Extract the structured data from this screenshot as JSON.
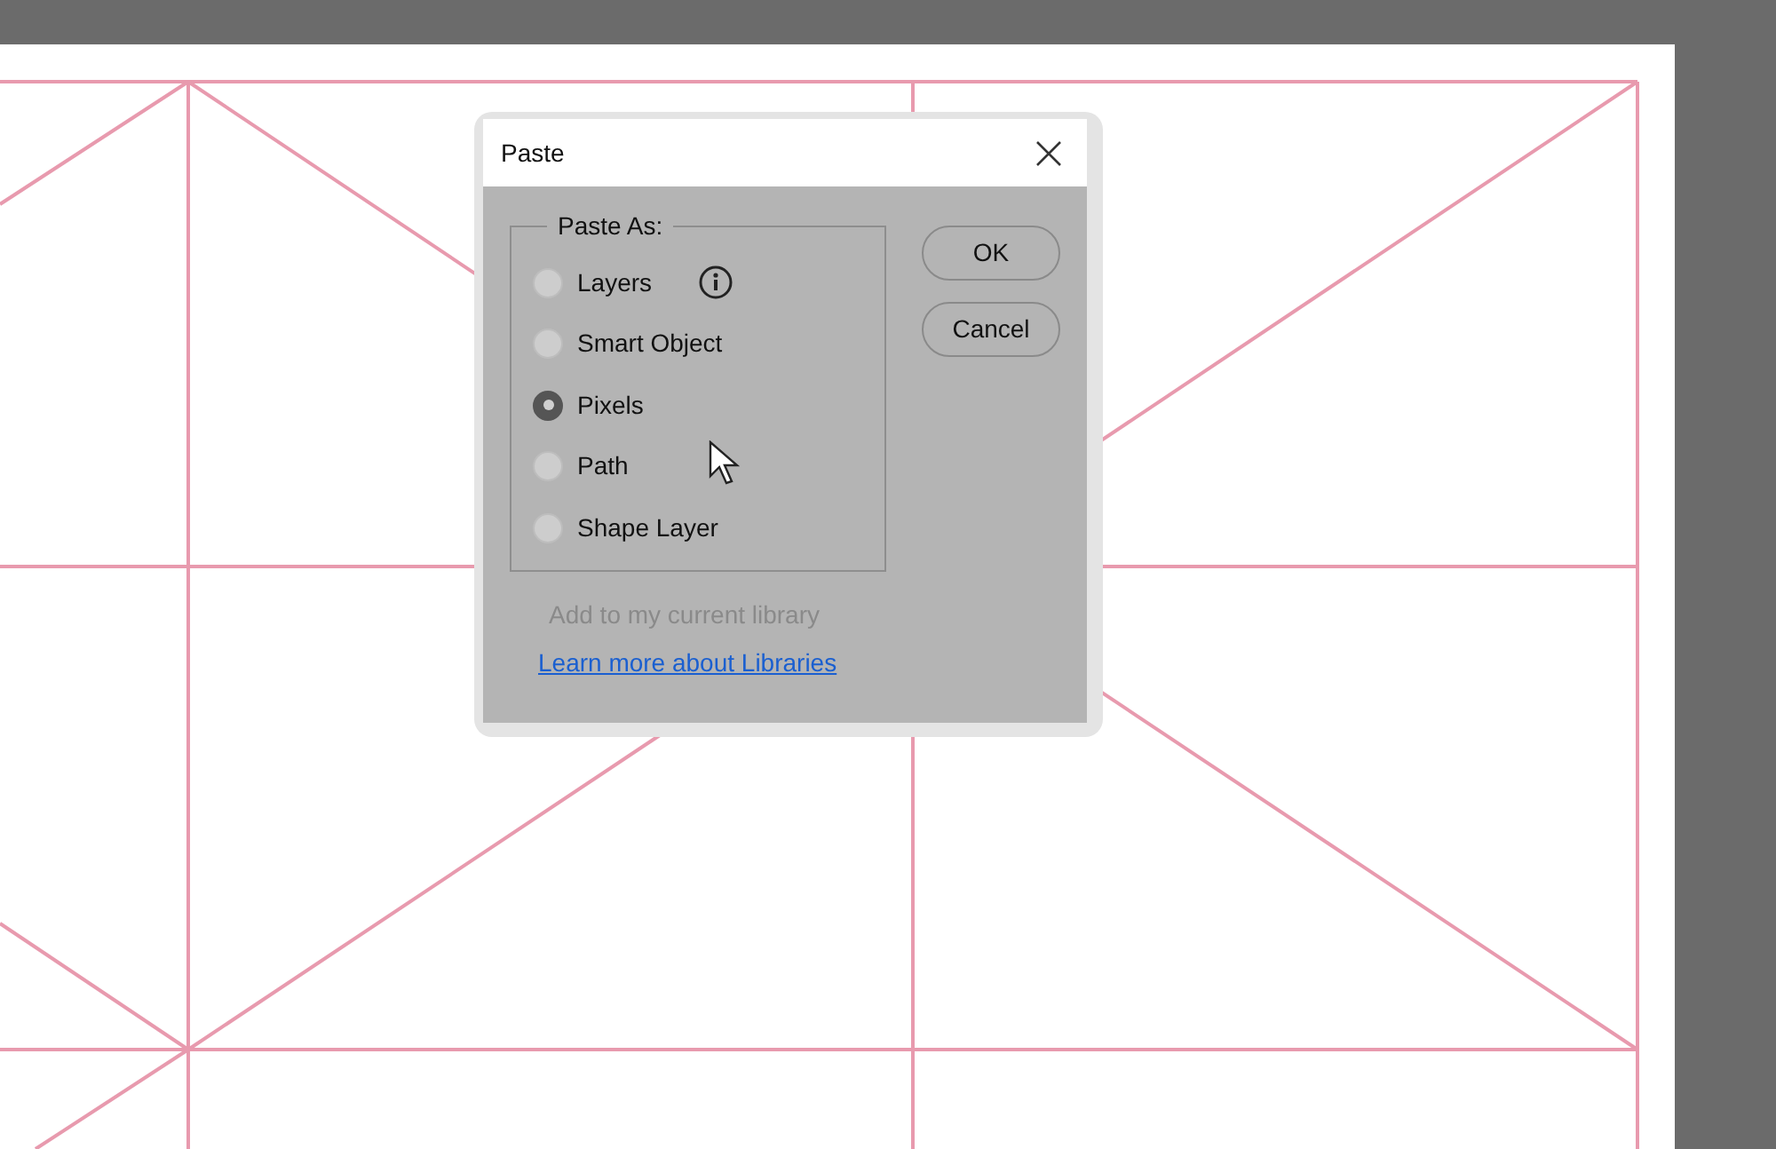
{
  "dialog": {
    "title": "Paste",
    "group_label": "Paste As:",
    "options": [
      {
        "label": "Layers",
        "selected": false,
        "info": true
      },
      {
        "label": "Smart Object",
        "selected": false
      },
      {
        "label": "Pixels",
        "selected": true
      },
      {
        "label": "Path",
        "selected": false
      },
      {
        "label": "Shape Layer",
        "selected": false
      }
    ],
    "library_option": {
      "label": "Add to my current library",
      "disabled": true
    },
    "link": "Learn more about Libraries",
    "buttons": [
      "OK",
      "Cancel"
    ]
  }
}
